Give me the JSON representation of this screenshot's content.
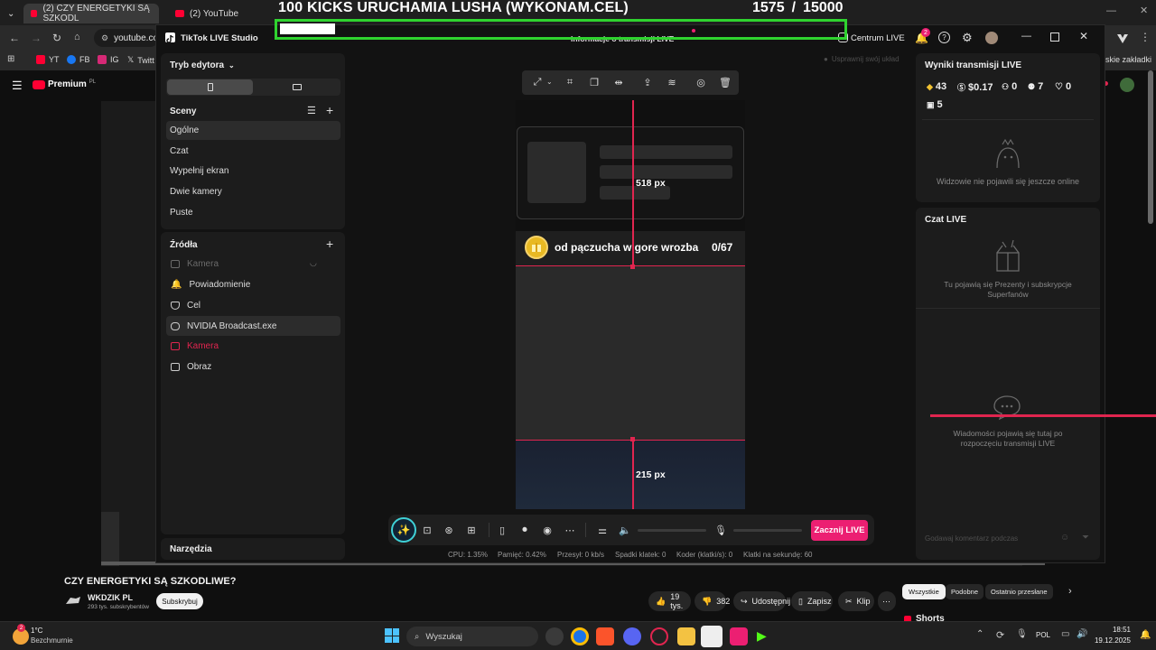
{
  "overlay": {
    "title": "100 KICKS URUCHAMIA LUSHA (WYKONAM.CEL)",
    "score": "1575",
    "score_sep": "/",
    "score_target": "15000"
  },
  "browser": {
    "tabs": [
      {
        "label": "(2) CZY ENERGETYKI SĄ SZKODL"
      },
      {
        "label": "(2) YouTube"
      }
    ],
    "url": "youtube.co",
    "bookmarks": [
      "YT",
      "FB",
      "IG",
      "Twitt"
    ],
    "bookmarks_right": "skie zakładki",
    "youtube_logo": "Premium",
    "youtube_region": "PL"
  },
  "studio": {
    "app_title": "TikTok LIVE Studio",
    "header_center": "Informacje o transmisji LIVE",
    "centrum": "Centrum LIVE",
    "notif_count": "2",
    "tryb_edytora": "Tryb edytora",
    "sceny_label": "Sceny",
    "scenes": [
      "Ogólne",
      "Czat",
      "Wypełnij ekran",
      "Dwie kamery",
      "Puste"
    ],
    "zrodla_label": "Źródła",
    "sources": [
      {
        "label": "Kamera",
        "icon": "camera-icon",
        "state": "hidden"
      },
      {
        "label": "Powiadomienie",
        "icon": "bell-icon",
        "state": "normal"
      },
      {
        "label": "Cel",
        "icon": "goal-icon",
        "state": "normal"
      },
      {
        "label": "NVIDIA Broadcast.exe",
        "icon": "game-icon",
        "state": "selected"
      },
      {
        "label": "Kamera",
        "icon": "camera-icon",
        "state": "error"
      },
      {
        "label": "Obraz",
        "icon": "image-icon",
        "state": "normal"
      }
    ],
    "narzedzia": "Narzędzia",
    "hint": "Usprawnij swój układ",
    "preview": {
      "measure_top": "518 px",
      "measure_bottom": "215 px",
      "goal_text": "od pączucha w gore wrozba",
      "goal_count": "0/67"
    },
    "results": {
      "title": "Wyniki transmisji LIVE",
      "diamonds": "43",
      "money": "$0.17",
      "viewers": "0",
      "followers": "7",
      "likes": "0",
      "gifts": "5",
      "empty_viewers": "Widzowie nie pojawili się jeszcze online"
    },
    "chat": {
      "title": "Czat LIVE",
      "gifts_empty": "Tu pojawią się Prezenty i subskrypcje Superfanów",
      "messages_empty": "Wiadomości pojawią się tutaj po rozpoczęciu transmisji LIVE",
      "input_placeholder": "Godawaj komentarz podczas"
    },
    "go_live": "Zacznij LIVE",
    "status": {
      "cpu": "CPU:  1.35%",
      "memory": "Pamięć:  0.42%",
      "bitrate": "Przesył:  0 kb/s",
      "dropped": "Spadki klatek:  0",
      "encoder": "Koder (klatki/s):  0",
      "fps": "Klatki na sekundę:  60"
    }
  },
  "youtube": {
    "video_title": "CZY ENERGETYKI SĄ SZKODLIWE?",
    "channel": "WKDZIK PL",
    "subs": "293 tys. subskrybentów",
    "subscribe": "Subskrybuj",
    "likes": "19 tys.",
    "dislikes": "382",
    "share": "Udostępnij",
    "save": "Zapisz",
    "clip": "Klip",
    "chips": [
      "Wszystkie",
      "Podobne",
      "Ostatnio przesłane"
    ],
    "shorts": "Shorts"
  },
  "taskbar": {
    "weather_temp": "1°C",
    "weather_desc": "Bezchmurnie",
    "weather_badge": "2",
    "search": "Wyszukaj",
    "lang": "POL",
    "time": "18:51",
    "date": "19.12.2025"
  },
  "colors": {
    "accent": "#ec1f72",
    "guide": "#e0254f",
    "overlay_green": "#2fd32f"
  }
}
